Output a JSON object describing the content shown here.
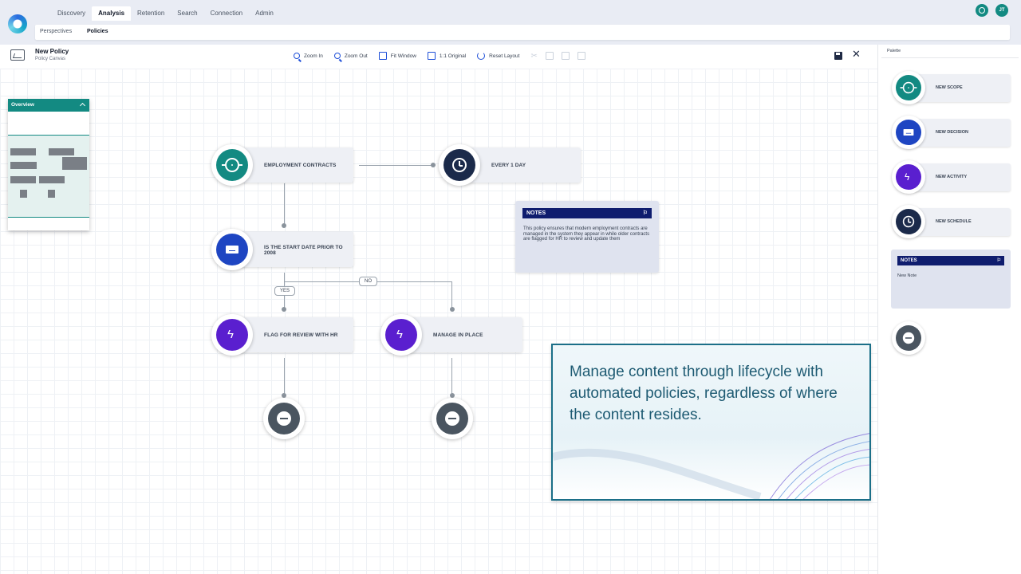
{
  "nav": {
    "tabs": [
      "Discovery",
      "Analysis",
      "Retention",
      "Search",
      "Connection",
      "Admin"
    ],
    "active_tab": "Analysis",
    "subtabs": [
      "Perspectives",
      "Policies"
    ],
    "active_subtab": "Policies",
    "user_initials": "JT"
  },
  "header": {
    "title": "New Policy",
    "subtitle": "Policy Canvas"
  },
  "toolbar": {
    "zoom_in": "Zoom In",
    "zoom_out": "Zoom Out",
    "fit_window": "Fit Window",
    "original": "1:1 Original",
    "reset_layout": "Reset Layout"
  },
  "overview": {
    "title": "Overview"
  },
  "flow": {
    "scope": "EMPLOYMENT CONTRACTS",
    "schedule": "EVERY 1 DAY",
    "decision": "IS THE START DATE PRIOR TO 2008",
    "yes_label": "YES",
    "no_label": "NO",
    "activity_yes": "FLAG FOR REVIEW WITH HR",
    "activity_no": "MANAGE IN PLACE"
  },
  "notes": {
    "title": "NOTES",
    "body": "This policy ensures that modern employment contracts are managed in the system they appear in while older contracts are flagged for HR to review and update them"
  },
  "promo": {
    "text": "Manage content through lifecycle with automated policies, regardless of where the content resides."
  },
  "palette": {
    "title": "Palette",
    "items": [
      "NEW SCOPE",
      "NEW DECISION",
      "NEW ACTIVITY",
      "NEW SCHEDULE"
    ],
    "notes_title": "NOTES",
    "notes_body": "New Note"
  },
  "colors": {
    "scope": "#138a82",
    "decision": "#1e45c2",
    "activity": "#5a1fcf",
    "schedule": "#1b2a4a",
    "end": "#4a5560",
    "notes_header": "#0f1d6e",
    "promo_border": "#1b6f88"
  },
  "icons": {
    "scope": "crosshair-icon",
    "decision": "decision-icon",
    "activity": "bolt-icon",
    "schedule": "clock-icon",
    "end": "stop-icon"
  }
}
